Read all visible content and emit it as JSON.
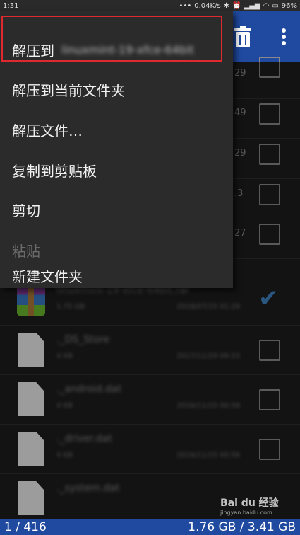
{
  "status_bar": {
    "time": "1:31",
    "net_speed": "0.04K/s",
    "battery": "96%"
  },
  "toolbar": {
    "delete_icon": "trash-icon",
    "more_icon": "more-vert-icon"
  },
  "menu": {
    "items": [
      {
        "label": "解压到",
        "blurred_suffix": "linuxmint-19-xfce-64bit",
        "enabled": true
      },
      {
        "label": "解压到当前文件夹",
        "enabled": true
      },
      {
        "label": "解压文件…",
        "enabled": true
      },
      {
        "label": "复制到剪贴板",
        "enabled": true
      },
      {
        "label": "剪切",
        "enabled": true
      },
      {
        "label": "粘贴",
        "enabled": false
      },
      {
        "label": "新建文件夹",
        "enabled": true
      }
    ]
  },
  "file_list": {
    "rows": [
      {
        "date_suffix": "29",
        "checked": false
      },
      {
        "date_suffix": "49",
        "checked": false
      },
      {
        "date_suffix": "29",
        "checked": false
      },
      {
        "date_suffix": ".3",
        "checked": false
      },
      {
        "date_suffix": "27",
        "checked": false
      },
      {
        "name": "linuxmint-19-xfce-64bit.rar",
        "size": "1.75 GB",
        "date": "2018/07/15 01:29",
        "type": "rar",
        "checked": true
      },
      {
        "name": "._DS_Store",
        "size": "4 KB",
        "date": "2017/11/29 09:23",
        "type": "file",
        "checked": false
      },
      {
        "name": "._android.dat",
        "size": "4 KB",
        "date": "2016/11/15 00:58",
        "type": "file",
        "checked": false
      },
      {
        "name": "._driver.dat",
        "size": "4 KB",
        "date": "2016/11/15 00:58",
        "type": "file",
        "checked": false
      },
      {
        "name": "._system.dat",
        "size": "",
        "date": "",
        "type": "file",
        "checked": false
      }
    ]
  },
  "bottom_bar": {
    "selection": "1 / 416",
    "storage": "1.76 GB / 3.41 GB"
  },
  "watermark": {
    "text": "Bai du 经验",
    "sub": "jingyan.baidu.com"
  }
}
